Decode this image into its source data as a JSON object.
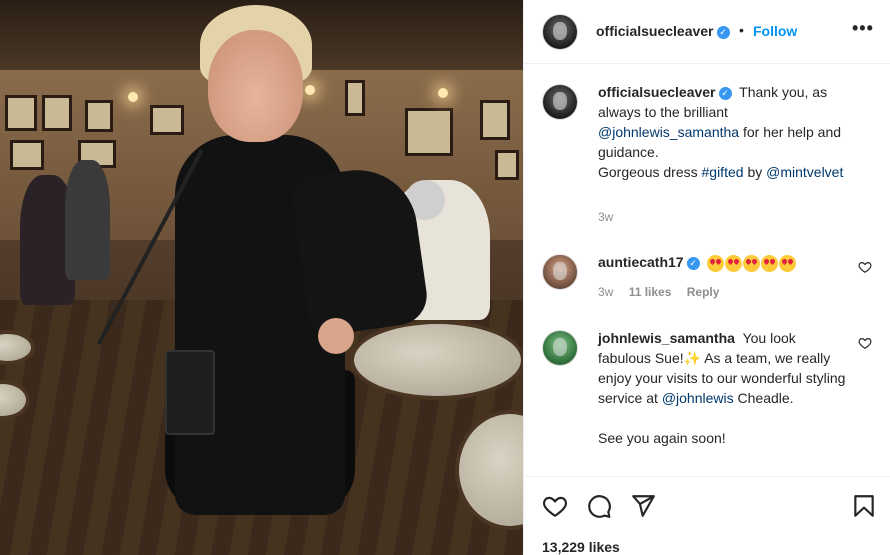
{
  "post": {
    "username": "officialsuecleaver",
    "verified": true,
    "dot": "•",
    "follow_label": "Follow",
    "more_label": "•••"
  },
  "caption": {
    "username": "officialsuecleaver",
    "text_1": "Thank you, as always to the brilliant",
    "mention_1": "@johnlewis_samantha",
    "text_2": "for her help and guidance.",
    "text_3": "Gorgeous dress",
    "hashtag": "#gifted",
    "text_4": "by",
    "mention_2": "@mintvelvet",
    "time": "3w"
  },
  "comments": [
    {
      "username": "auntiecath17",
      "verified": true,
      "emoji_name": "heart-eyes-emoji",
      "emoji_count": 5,
      "time": "3w",
      "likes": "11 likes",
      "reply": "Reply"
    },
    {
      "username": "johnlewis_samantha",
      "text_1": "You look fabulous Sue!",
      "sparkle": "✨",
      "text_2": "As a team, we really enjoy your visits to our wonderful styling service at",
      "mention": "@johnlewis",
      "text_3": "Cheadle.",
      "text_4": "See you again soon!"
    }
  ],
  "footer": {
    "likes": "13,229 likes"
  },
  "icons": {
    "like": "heart-icon",
    "comment": "comment-icon",
    "share": "share-icon",
    "save": "bookmark-icon"
  },
  "colors": {
    "link": "#00376b",
    "follow": "#0095f6",
    "verified": "#3897f0"
  }
}
